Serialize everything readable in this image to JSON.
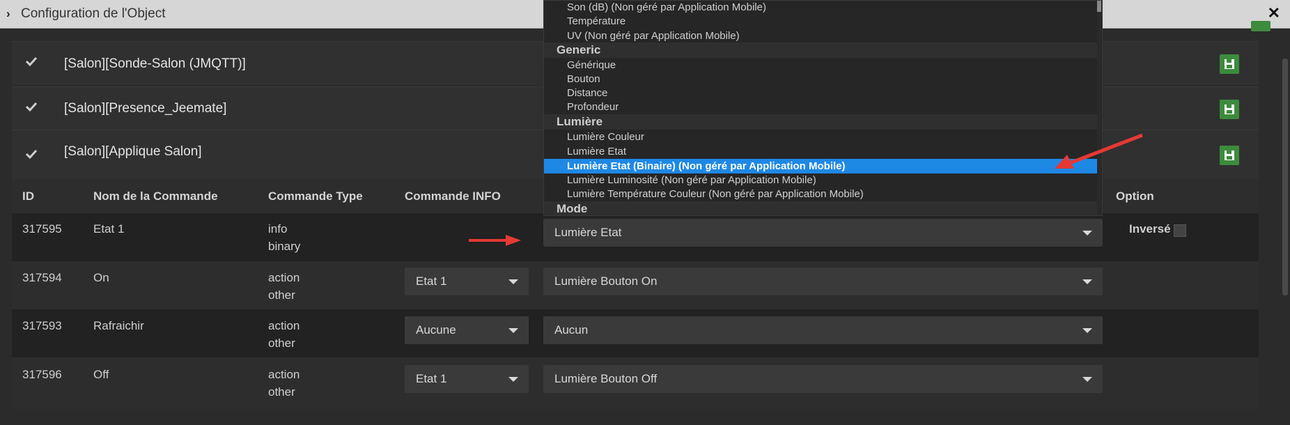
{
  "window": {
    "title": "Configuration de l'Object",
    "close_label": "✕",
    "chevron": "›"
  },
  "equipments": [
    {
      "name": "[Salon][Sonde-Salon (JMQTT)]"
    },
    {
      "name": "[Salon][Presence_Jeemate]"
    },
    {
      "name": "[Salon][Applique Salon]"
    }
  ],
  "table": {
    "headers": {
      "id": "ID",
      "name": "Nom de la Commande",
      "type": "Commande Type",
      "info": "Commande INFO",
      "option": "Option"
    },
    "rows": [
      {
        "id": "317595",
        "name": "Etat 1",
        "type1": "info",
        "type2": "binary",
        "info": "",
        "generic": "Lumière Etat",
        "option_label": "Inversé"
      },
      {
        "id": "317594",
        "name": "On",
        "type1": "action",
        "type2": "other",
        "info": "Etat 1",
        "generic": "Lumière Bouton On"
      },
      {
        "id": "317593",
        "name": "Rafraichir",
        "type1": "action",
        "type2": "other",
        "info": "Aucune",
        "generic": "Aucun"
      },
      {
        "id": "317596",
        "name": "Off",
        "type1": "action",
        "type2": "other",
        "info": "Etat 1",
        "generic": "Lumière Bouton Off"
      }
    ]
  },
  "dropdown": {
    "items": [
      {
        "kind": "item",
        "label": "Son (dB) (Non géré par Application Mobile)"
      },
      {
        "kind": "item",
        "label": "Température"
      },
      {
        "kind": "item",
        "label": "UV (Non géré par Application Mobile)"
      },
      {
        "kind": "group",
        "label": "Generic"
      },
      {
        "kind": "item",
        "label": "Générique"
      },
      {
        "kind": "item",
        "label": "Bouton"
      },
      {
        "kind": "item",
        "label": "Distance"
      },
      {
        "kind": "item",
        "label": "Profondeur"
      },
      {
        "kind": "group",
        "label": "Lumière"
      },
      {
        "kind": "item",
        "label": "Lumière Couleur"
      },
      {
        "kind": "item",
        "label": "Lumière Etat"
      },
      {
        "kind": "item",
        "label": "Lumière Etat (Binaire) (Non géré par Application Mobile)",
        "selected": true
      },
      {
        "kind": "item",
        "label": "Lumière Luminosité (Non géré par Application Mobile)"
      },
      {
        "kind": "item",
        "label": "Lumière Température Couleur (Non géré par Application Mobile)"
      },
      {
        "kind": "group",
        "label": "Mode"
      }
    ]
  },
  "colors": {
    "accent": "#1e88e5",
    "save": "#3d8b3d",
    "annotation_arrow": "#e53935"
  }
}
